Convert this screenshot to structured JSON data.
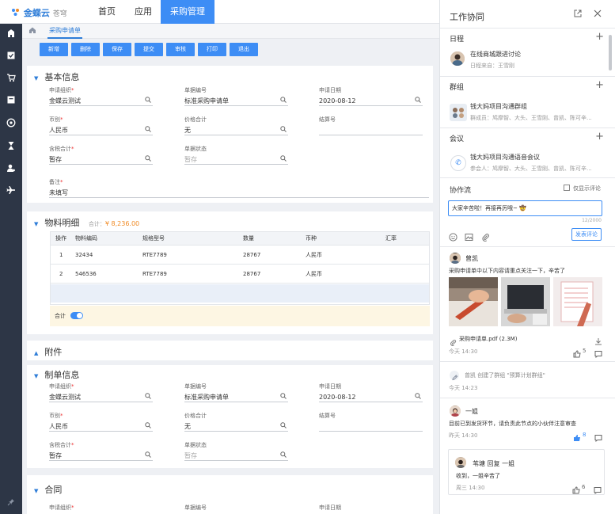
{
  "app": {
    "logo_text": "金蝶云",
    "logo_sub": "苍穹"
  },
  "nav": {
    "home": "首页",
    "apps": "应用",
    "procure": "采购管理"
  },
  "tab": {
    "label": "采购申请单"
  },
  "toolbar": [
    "新增",
    "删除",
    "保存",
    "提交",
    "审核",
    "打印",
    "退出"
  ],
  "basic": {
    "title": "基本信息",
    "fields": [
      {
        "label": "申请组织",
        "required": true,
        "value": "金蝶云测试",
        "icon": true,
        "disabled": false
      },
      {
        "label": "单据编号",
        "required": false,
        "value": "标准采购申请单",
        "icon": true,
        "disabled": false
      },
      {
        "label": "申请日期",
        "required": false,
        "value": "2020-08-12",
        "icon": true,
        "disabled": false
      },
      {
        "label": "币别",
        "required": true,
        "value": "人民币",
        "icon": true,
        "disabled": false
      },
      {
        "label": "价格合计",
        "required": false,
        "value": "无",
        "icon": true,
        "disabled": false
      },
      {
        "label": "结算号",
        "required": false,
        "value": "",
        "icon": false,
        "disabled": false
      },
      {
        "label": "含税合计",
        "required": true,
        "value": "暂存",
        "icon": true,
        "disabled": false
      },
      {
        "label": "单据状态",
        "required": false,
        "value": "暂存",
        "icon": true,
        "disabled": true
      }
    ],
    "note_label": "备注",
    "note_value": "未填写"
  },
  "material": {
    "title": "物料明细",
    "total_label": "合计：",
    "total_value": "¥ 8,236.00",
    "columns": [
      "操作",
      "物料编码",
      "规格型号",
      "数量",
      "币种",
      "汇率"
    ],
    "rows": [
      [
        "1",
        "32434",
        "RTE7789",
        "28767",
        "人民币",
        ""
      ],
      [
        "2",
        "546536",
        "RTE7789",
        "28767",
        "人民币",
        ""
      ]
    ],
    "sum_label": "合计"
  },
  "attach": {
    "title": "附件"
  },
  "maker": {
    "title": "制单信息",
    "fields": [
      {
        "label": "申请组织",
        "required": true,
        "value": "金蝶云测试",
        "icon": true,
        "disabled": false
      },
      {
        "label": "单据编号",
        "required": false,
        "value": "标准采购申请单",
        "icon": true,
        "disabled": false
      },
      {
        "label": "申请日期",
        "required": false,
        "value": "2020-08-12",
        "icon": true,
        "disabled": false
      },
      {
        "label": "币别",
        "required": true,
        "value": "人民币",
        "icon": true,
        "disabled": false
      },
      {
        "label": "价格合计",
        "required": false,
        "value": "无",
        "icon": true,
        "disabled": false
      },
      {
        "label": "结算号",
        "required": false,
        "value": "",
        "icon": false,
        "disabled": false
      },
      {
        "label": "含税合计",
        "required": true,
        "value": "暂存",
        "icon": true,
        "disabled": false
      },
      {
        "label": "单据状态",
        "required": false,
        "value": "暂存",
        "icon": true,
        "disabled": true
      }
    ]
  },
  "contract": {
    "title": "合同",
    "labels": [
      "申请组织",
      "单据编号",
      "申请日期"
    ]
  },
  "collab": {
    "title": "工作协同",
    "schedule": {
      "label": "日程",
      "title": "在线商城跟进讨论",
      "sub": "日程来自：王雪刚"
    },
    "group": {
      "label": "群组",
      "title": "钱大妈项目沟通群组",
      "sub": "群成员：鸠摩智、大头、王雪刚、曾凯、陈可辛..."
    },
    "meeting": {
      "label": "会议",
      "title": "钱大妈项目沟通语音会议",
      "sub": "参会人：鸠摩智、大头、王雪刚、曾凯、陈可辛..."
    },
    "flow": {
      "label": "协作流",
      "only_comments": "仅显示评论",
      "input_value": "大家辛苦啦！再接再厉哦~ 🤠",
      "counter": "12/2000",
      "post": "发表评论"
    },
    "post1": {
      "name": "曾凯",
      "text": "采购申请单中以下内容请重点关注一下，辛苦了",
      "file": "采购申请单.pdf (2.3M)",
      "time": "今天  14:30",
      "likes": "5"
    },
    "event": {
      "text": "曾凯 创建了群组 \"预算计划群组\"",
      "time": "今天  14:23"
    },
    "post2": {
      "name": "一姐",
      "text": "目前已到发货环节，请负责此节点的小伙伴注意审查",
      "time": "昨天  14:30",
      "likes": "8"
    },
    "reply": {
      "title": "苇塘 回复 一姐",
      "text": "收到，一姐辛苦了",
      "time": "周三  14:30",
      "likes": "6"
    }
  },
  "colors": {
    "accent": "#3d8df5",
    "sidebar": "#2d3646",
    "total": "#f08a24"
  }
}
